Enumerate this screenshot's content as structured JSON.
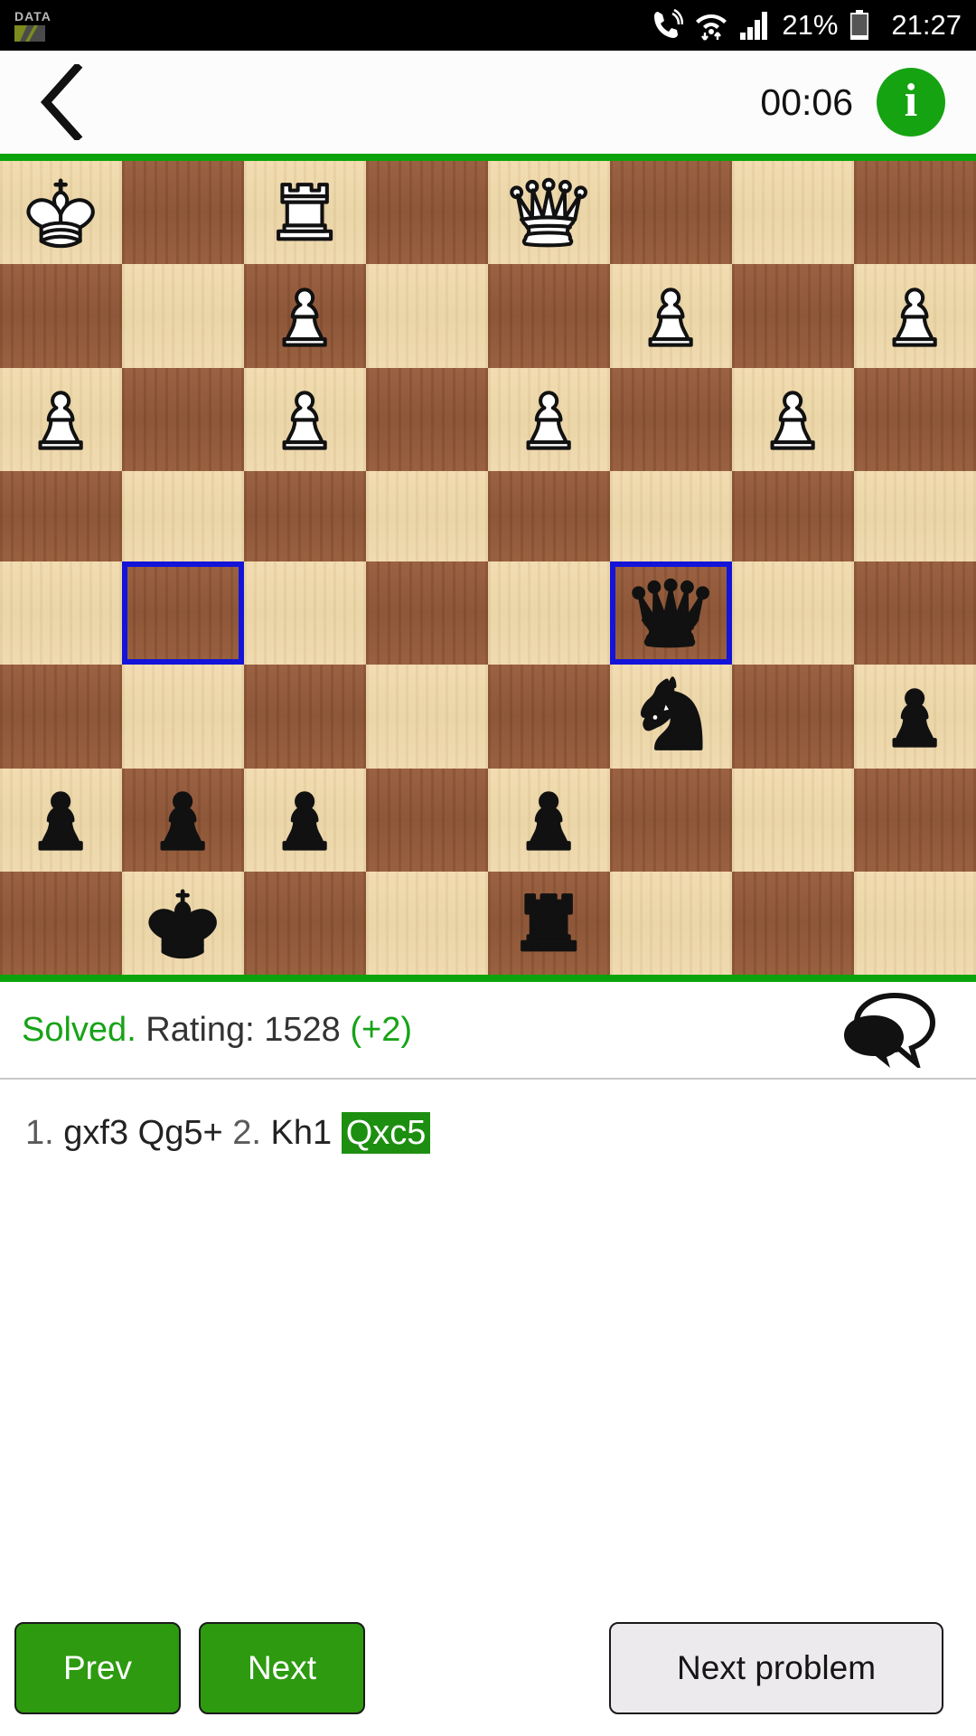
{
  "statusbar": {
    "data_label": "DATA",
    "battery": "21%",
    "time": "21:27",
    "icons": [
      "call-icon",
      "wifi-data-icon",
      "signal-bars-icon",
      "battery-icon"
    ]
  },
  "appbar": {
    "back_icon": "back-chevron-icon",
    "timer": "00:06",
    "info_label": "i",
    "info_icon": "info-icon"
  },
  "board": {
    "accent_green": "#0ba30b",
    "highlight_color": "#1414d8",
    "light_square": "#eed9ab",
    "dark_square": "#94603f",
    "files": [
      "a",
      "b",
      "c",
      "d",
      "e",
      "f",
      "g",
      "h"
    ],
    "ranks": [
      "8",
      "7",
      "6",
      "5",
      "4",
      "3",
      "2",
      "1"
    ],
    "rows": [
      [
        {
          "piece": "white-king",
          "highlight": false
        },
        {
          "piece": null,
          "highlight": false
        },
        {
          "piece": "white-rook",
          "highlight": false
        },
        {
          "piece": null,
          "highlight": false
        },
        {
          "piece": "white-queen",
          "highlight": false
        },
        {
          "piece": null,
          "highlight": false
        },
        {
          "piece": null,
          "highlight": false
        },
        {
          "piece": null,
          "highlight": false
        }
      ],
      [
        {
          "piece": null,
          "highlight": false
        },
        {
          "piece": null,
          "highlight": false
        },
        {
          "piece": "white-pawn",
          "highlight": false
        },
        {
          "piece": null,
          "highlight": false
        },
        {
          "piece": null,
          "highlight": false
        },
        {
          "piece": "white-pawn",
          "highlight": false
        },
        {
          "piece": null,
          "highlight": false
        },
        {
          "piece": "white-pawn",
          "highlight": false
        }
      ],
      [
        {
          "piece": "white-pawn",
          "highlight": false
        },
        {
          "piece": null,
          "highlight": false
        },
        {
          "piece": "white-pawn",
          "highlight": false
        },
        {
          "piece": null,
          "highlight": false
        },
        {
          "piece": "white-pawn",
          "highlight": false
        },
        {
          "piece": null,
          "highlight": false
        },
        {
          "piece": "white-pawn",
          "highlight": false
        },
        {
          "piece": null,
          "highlight": false
        }
      ],
      [
        {
          "piece": null,
          "highlight": false
        },
        {
          "piece": null,
          "highlight": false
        },
        {
          "piece": null,
          "highlight": false
        },
        {
          "piece": null,
          "highlight": false
        },
        {
          "piece": null,
          "highlight": false
        },
        {
          "piece": null,
          "highlight": false
        },
        {
          "piece": null,
          "highlight": false
        },
        {
          "piece": null,
          "highlight": false
        }
      ],
      [
        {
          "piece": null,
          "highlight": false
        },
        {
          "piece": null,
          "highlight": true
        },
        {
          "piece": null,
          "highlight": false
        },
        {
          "piece": null,
          "highlight": false
        },
        {
          "piece": null,
          "highlight": false
        },
        {
          "piece": "black-queen",
          "highlight": true
        },
        {
          "piece": null,
          "highlight": false
        },
        {
          "piece": null,
          "highlight": false
        }
      ],
      [
        {
          "piece": null,
          "highlight": false
        },
        {
          "piece": null,
          "highlight": false
        },
        {
          "piece": null,
          "highlight": false
        },
        {
          "piece": null,
          "highlight": false
        },
        {
          "piece": null,
          "highlight": false
        },
        {
          "piece": "black-knight",
          "highlight": false
        },
        {
          "piece": null,
          "highlight": false
        },
        {
          "piece": "black-pawn",
          "highlight": false
        }
      ],
      [
        {
          "piece": "black-pawn",
          "highlight": false
        },
        {
          "piece": "black-pawn",
          "highlight": false
        },
        {
          "piece": "black-pawn",
          "highlight": false
        },
        {
          "piece": null,
          "highlight": false
        },
        {
          "piece": "black-pawn",
          "highlight": false
        },
        {
          "piece": null,
          "highlight": false
        },
        {
          "piece": null,
          "highlight": false
        },
        {
          "piece": null,
          "highlight": false
        }
      ],
      [
        {
          "piece": null,
          "highlight": false
        },
        {
          "piece": "black-king",
          "highlight": false
        },
        {
          "piece": null,
          "highlight": false
        },
        {
          "piece": null,
          "highlight": false
        },
        {
          "piece": "black-rook",
          "highlight": false
        },
        {
          "piece": null,
          "highlight": false
        },
        {
          "piece": null,
          "highlight": false
        },
        {
          "piece": null,
          "highlight": false
        }
      ]
    ]
  },
  "result": {
    "status": "Solved.",
    "rating_label": " Rating: 1528 ",
    "delta": "(+2)",
    "chat_icon": "speech-bubbles-icon"
  },
  "moves": {
    "line": [
      {
        "text": "1.",
        "type": "num"
      },
      {
        "text": "gxf3",
        "type": "move"
      },
      {
        "text": "Qg5+",
        "type": "move"
      },
      {
        "text": "2.",
        "type": "num"
      },
      {
        "text": "Kh1",
        "type": "move"
      },
      {
        "text": "Qxc5",
        "type": "current"
      }
    ]
  },
  "buttons": {
    "prev": "Prev",
    "next": "Next",
    "next_problem": "Next problem"
  }
}
